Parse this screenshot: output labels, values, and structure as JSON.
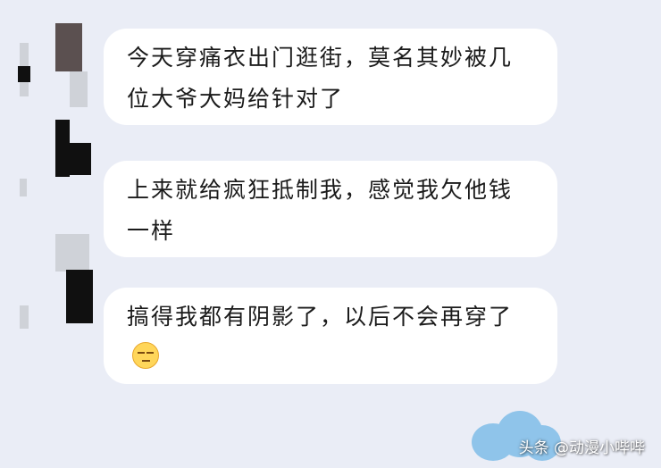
{
  "messages": [
    {
      "text": "今天穿痛衣出门逛街，莫名其妙被几位大爷大妈给针对了",
      "emoji": null
    },
    {
      "text": "上来就给疯狂抵制我，感觉我欠他钱一样",
      "emoji": null
    },
    {
      "text": "搞得我都有阴影了，以后不会再穿了",
      "emoji": "unamused-face-icon"
    }
  ],
  "watermark": "头条 @动漫小哔哔",
  "colors": {
    "background": "#eaedf6",
    "bubble": "#ffffff",
    "text": "#1b1b1b"
  }
}
